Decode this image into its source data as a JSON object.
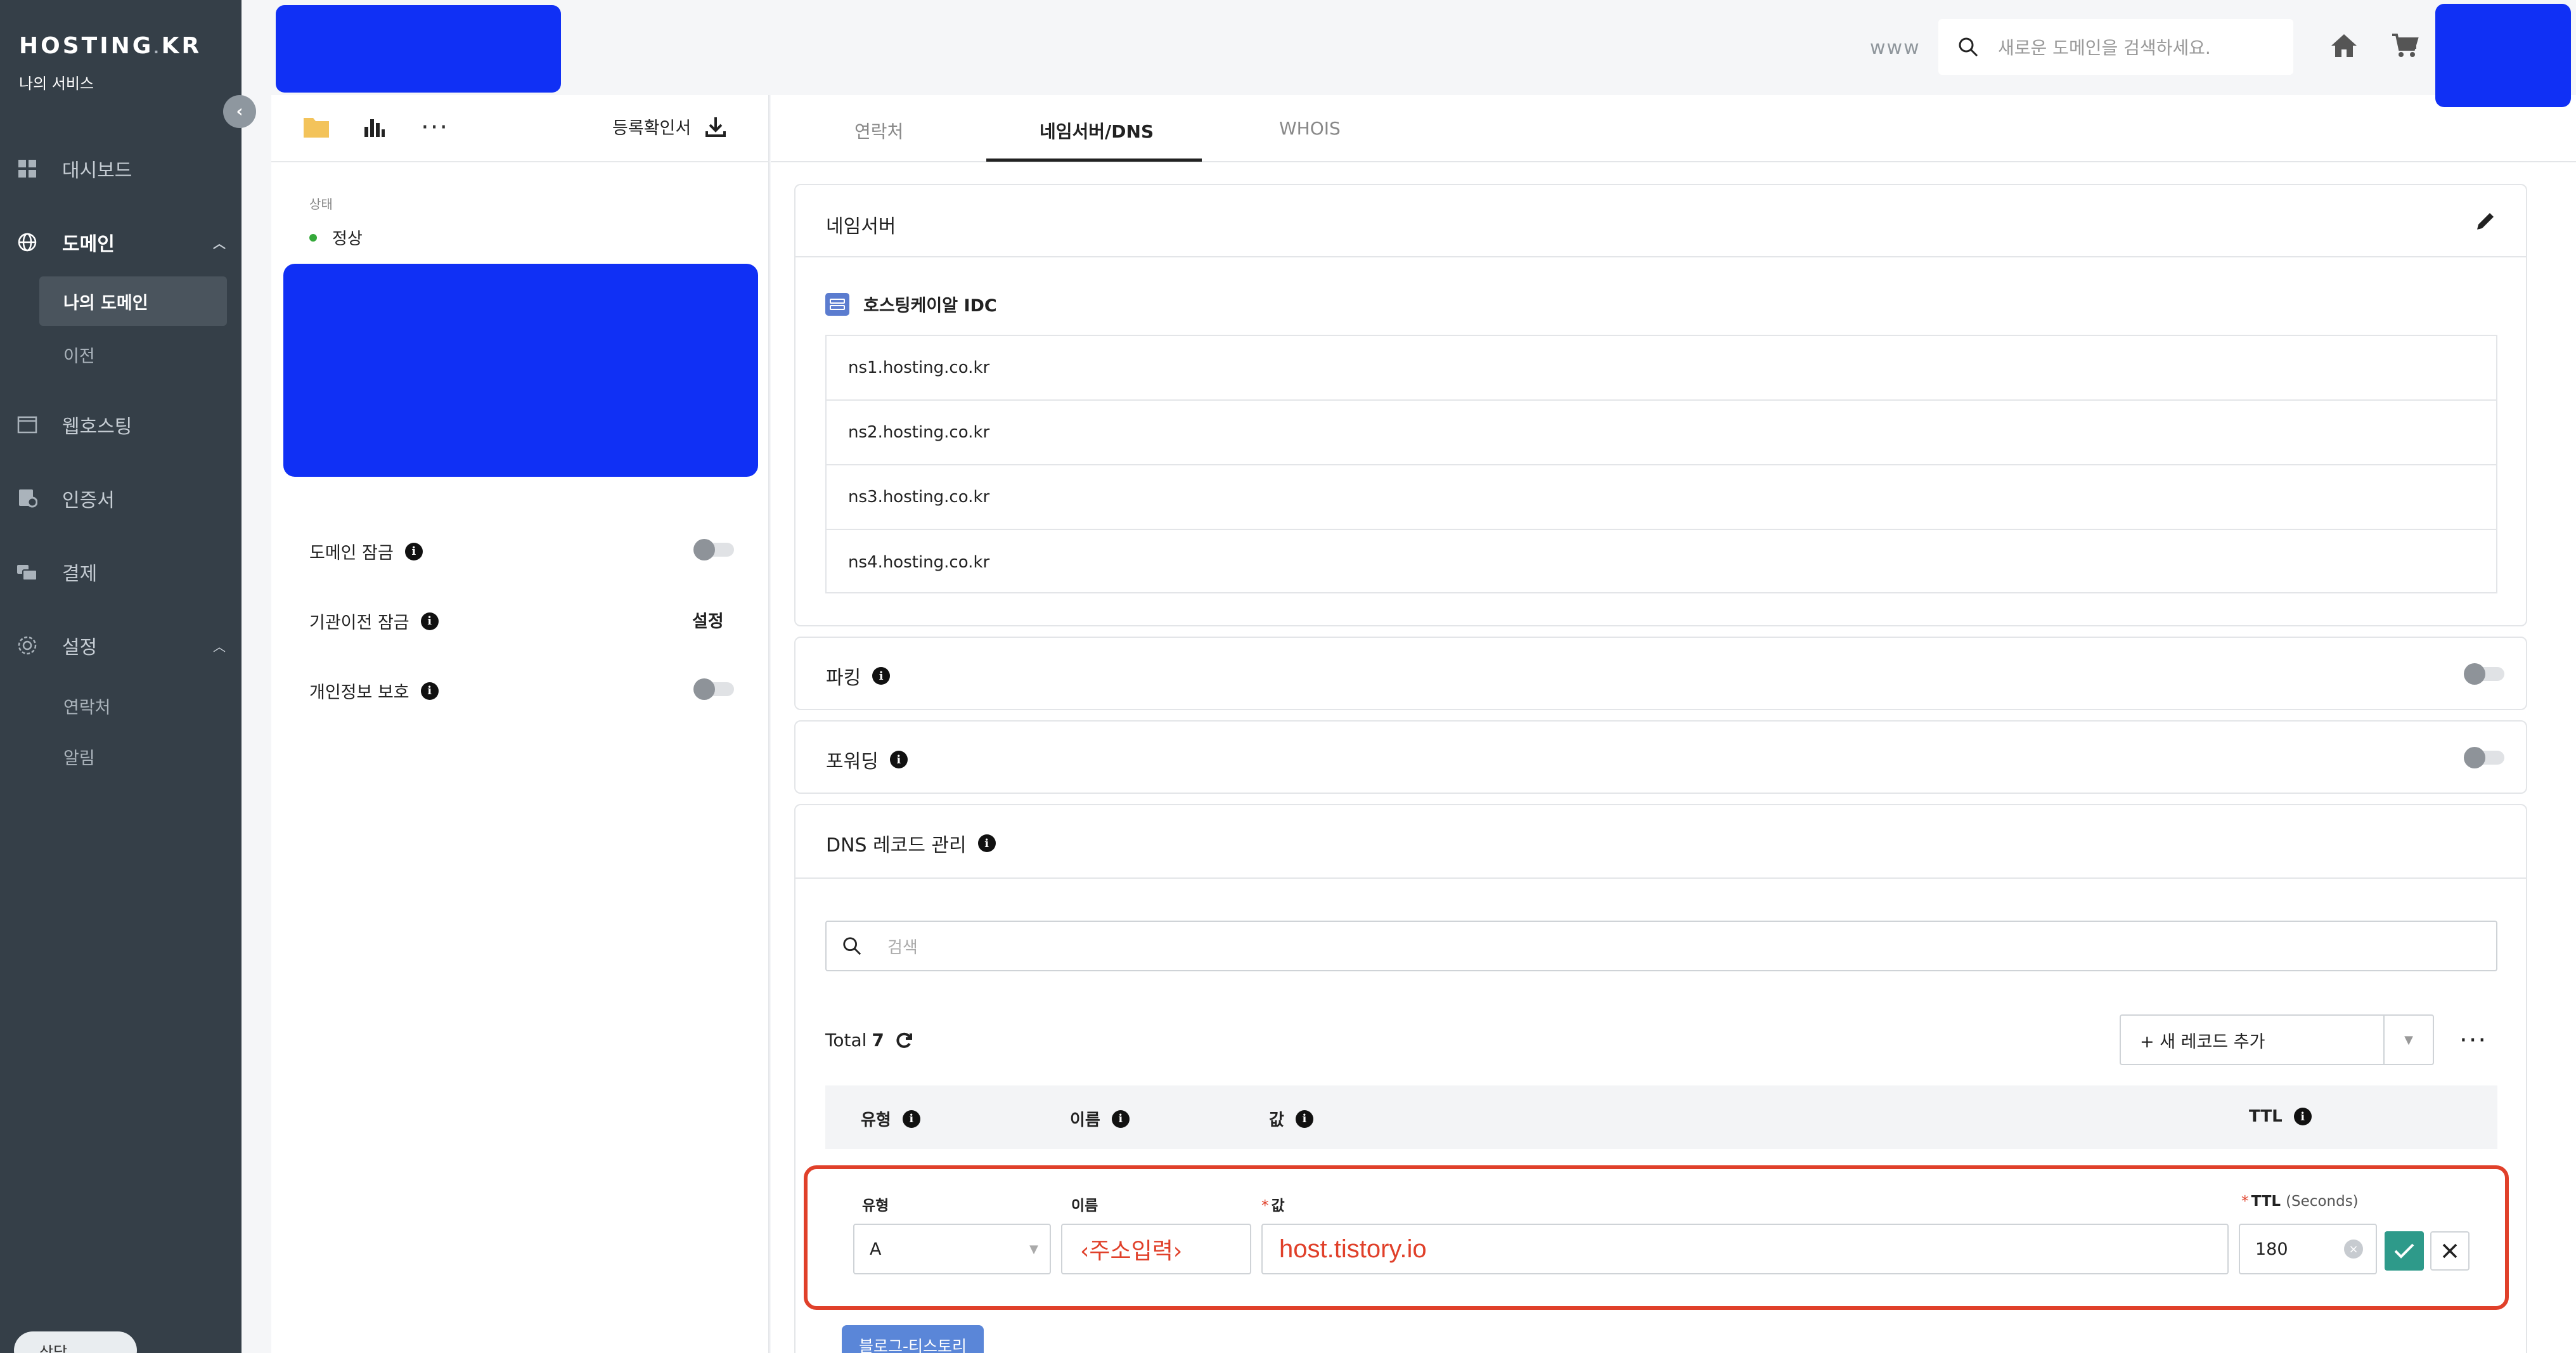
{
  "sidebar": {
    "logo": "HOSTING",
    "logo_dot": ".",
    "logo_suffix": "KR",
    "service_label": "나의 서비스",
    "items": [
      {
        "label": "대시보드"
      },
      {
        "label": "도메인"
      },
      {
        "label": "웹호스팅"
      },
      {
        "label": "인증서"
      },
      {
        "label": "결제"
      },
      {
        "label": "설정"
      }
    ],
    "domain_sub": [
      {
        "label": "나의 도메인"
      },
      {
        "label": "이전"
      }
    ],
    "settings_sub": [
      {
        "label": "연락처"
      },
      {
        "label": "알림"
      }
    ],
    "chat_label": "상담"
  },
  "topbar": {
    "www_label": "www",
    "search_placeholder": "새로운 도메인을 검색하세요."
  },
  "left_panel": {
    "reg_cert_label": "등록확인서",
    "status_label": "상태",
    "status_value": "정상",
    "domain_lock_label": "도메인 잠금",
    "transfer_lock_label": "기관이전 잠금",
    "transfer_lock_action": "설정",
    "privacy_label": "개인정보 보호"
  },
  "tabs": [
    {
      "label": "연락처"
    },
    {
      "label": "네임서버/DNS"
    },
    {
      "label": "WHOIS"
    }
  ],
  "nameserver": {
    "title": "네임서버",
    "provider": "호스팅케이알 IDC",
    "servers": [
      "ns1.hosting.co.kr",
      "ns2.hosting.co.kr",
      "ns3.hosting.co.kr",
      "ns4.hosting.co.kr"
    ]
  },
  "parking": {
    "title": "파킹"
  },
  "forwarding": {
    "title": "포워딩"
  },
  "dns": {
    "title": "DNS 레코드 관리",
    "search_placeholder": "검색",
    "total_label": "Total",
    "total_count": "7",
    "add_record_label": "+ 새 레코드 추가",
    "columns": {
      "type": "유형",
      "name": "이름",
      "value": "값",
      "ttl": "TTL"
    },
    "edit_row": {
      "type_label": "유형",
      "name_label": "이름",
      "value_label": "값",
      "ttl_label": "TTL",
      "ttl_unit": "(Seconds)",
      "type_value": "A",
      "name_value": "‹주소입력›",
      "value_value": "host.tistory.io",
      "ttl_value": "180"
    },
    "tag_label": "블로그-티스토리"
  },
  "colors": {
    "sidebar_bg": "#353f48",
    "redacted_blue": "#1030f5",
    "highlight_red": "#e0402a",
    "confirm_teal": "#2e9a8a",
    "tag_blue": "#5a86d8"
  }
}
